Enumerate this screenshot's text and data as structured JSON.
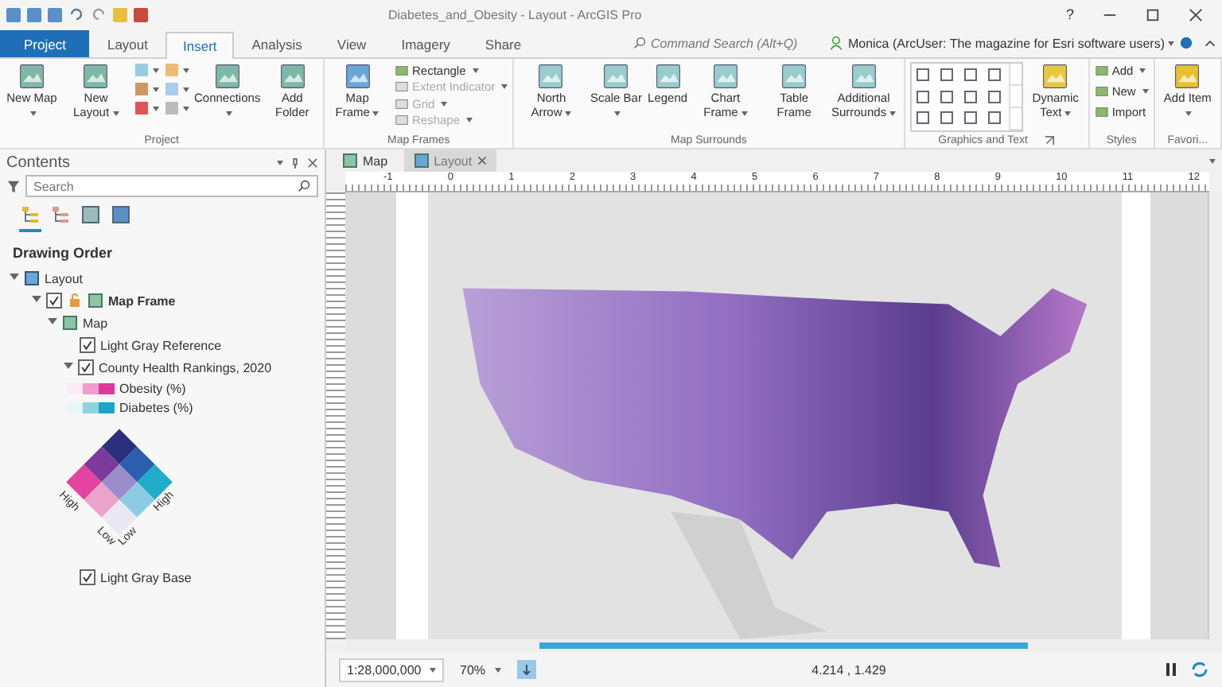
{
  "window": {
    "title": "Diabetes_and_Obesity - Layout - ArcGIS Pro",
    "help": "?"
  },
  "ribbon_tabs": [
    {
      "label": "Project",
      "kind": "file",
      "selected": false
    },
    {
      "label": "Layout",
      "kind": "tab",
      "selected": false
    },
    {
      "label": "Insert",
      "kind": "tab",
      "selected": true
    },
    {
      "label": "Analysis",
      "kind": "tab",
      "selected": false
    },
    {
      "label": "View",
      "kind": "tab",
      "selected": false
    },
    {
      "label": "Imagery",
      "kind": "tab",
      "selected": false
    },
    {
      "label": "Share",
      "kind": "tab",
      "selected": false
    }
  ],
  "command_search": {
    "placeholder": "Command Search (Alt+Q)"
  },
  "user": {
    "name": "Monica (ArcUser: The magazine for Esri software users)"
  },
  "ribbon_groups": [
    {
      "title": "Project",
      "buttons": [
        {
          "label": "New Map",
          "kind": "large",
          "dropdown": true
        },
        {
          "label": "New Layout",
          "kind": "large",
          "dropdown": true
        },
        {
          "kind": "icongrid"
        },
        {
          "label": "Connections",
          "kind": "large",
          "dropdown": true
        },
        {
          "label": "Add Folder",
          "kind": "large",
          "dropdown": false
        }
      ]
    },
    {
      "title": "Map Frames",
      "buttons": [
        {
          "label": "Map Frame",
          "kind": "large",
          "dropdown": true,
          "disabled": false
        },
        {
          "label": "Rectangle",
          "kind": "small",
          "dropdown": true,
          "disabled": false
        },
        {
          "label": "Extent Indicator",
          "kind": "small",
          "dropdown": true,
          "disabled": true
        },
        {
          "label": "Grid",
          "kind": "small",
          "dropdown": true,
          "disabled": true
        },
        {
          "label": "Reshape",
          "kind": "small",
          "dropdown": true,
          "disabled": true
        }
      ]
    },
    {
      "title": "Map Surrounds",
      "buttons": [
        {
          "label": "North Arrow",
          "kind": "large",
          "dropdown": true
        },
        {
          "label": "Scale Bar",
          "kind": "large",
          "dropdown": true
        },
        {
          "label": "Legend",
          "kind": "large",
          "dropdown": false
        },
        {
          "label": "Chart Frame",
          "kind": "large",
          "dropdown": true
        },
        {
          "label": "Table Frame",
          "kind": "large",
          "dropdown": false
        },
        {
          "label": "Additional Surrounds",
          "kind": "large",
          "dropdown": true
        }
      ]
    },
    {
      "title": "Graphics and Text",
      "launcher": true,
      "buttons": [
        {
          "kind": "gallery"
        },
        {
          "label": "Dynamic Text",
          "kind": "large",
          "dropdown": true
        }
      ]
    },
    {
      "title": "Styles",
      "buttons": [
        {
          "label": "Add",
          "kind": "small",
          "dropdown": true
        },
        {
          "label": "New",
          "kind": "small",
          "dropdown": true
        },
        {
          "label": "Import",
          "kind": "small",
          "dropdown": false
        }
      ]
    },
    {
      "title": "Favori...",
      "buttons": [
        {
          "label": "Add Item",
          "kind": "large",
          "dropdown": true
        }
      ]
    }
  ],
  "contents": {
    "title": "Contents",
    "search": {
      "placeholder": "Search"
    },
    "views": [
      {
        "selected": true
      },
      {
        "selected": false
      },
      {
        "selected": false
      },
      {
        "selected": false
      }
    ],
    "heading": "Drawing Order",
    "tree": [
      {
        "label": "Layout",
        "kind": "layout",
        "expanded": true,
        "children": [
          {
            "label": "Map Frame",
            "kind": "frame",
            "checked": true,
            "expanded": true,
            "children": [
              {
                "label": "Map",
                "kind": "map",
                "expanded": true,
                "children": [
                  {
                    "label": "Light Gray Reference",
                    "kind": "layer",
                    "checked": true
                  },
                  {
                    "label": "County Health Rankings, 2020",
                    "kind": "layer",
                    "checked": true,
                    "expanded": true,
                    "children": [
                      {
                        "label": "Obesity (%)",
                        "kind": "ramp",
                        "color": "#e0379a"
                      },
                      {
                        "label": "Diabetes (%)",
                        "kind": "ramp",
                        "color": "#1ba6c4"
                      },
                      {
                        "kind": "bivariate",
                        "labels": [
                          "High",
                          "Low",
                          "Low",
                          "High"
                        ]
                      }
                    ]
                  },
                  {
                    "label": "Light Gray Base",
                    "kind": "layer",
                    "checked": true
                  }
                ]
              }
            ]
          }
        ]
      }
    ]
  },
  "view_tabs": [
    {
      "label": "Map",
      "selected": false,
      "closable": false
    },
    {
      "label": "Layout",
      "selected": true,
      "closable": true
    }
  ],
  "ruler": [
    "-1",
    "0",
    "1",
    "2",
    "3",
    "4",
    "5",
    "6",
    "7",
    "8",
    "9",
    "10",
    "11",
    "12"
  ],
  "status_bar": {
    "scale": "1:28,000,000",
    "zoom": "70%",
    "coordinates": "4.214 , 1.429"
  }
}
